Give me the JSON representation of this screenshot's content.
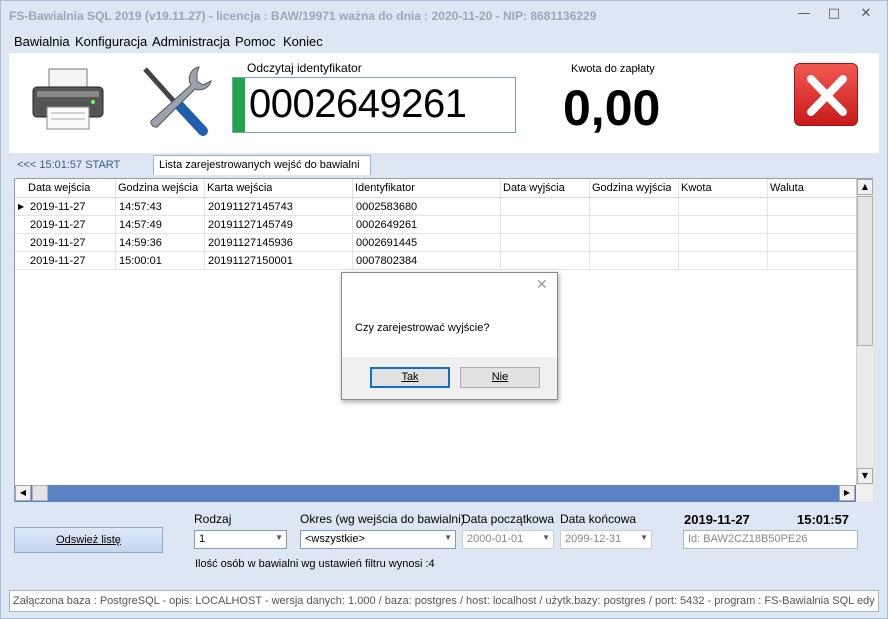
{
  "window": {
    "title": "FS-Bawialnia SQL 2019 (v19.11.27)   -   licencja : BAW/19971   ważna do dnia : 2020-11-20   -   NIP: 8681136229"
  },
  "menu": [
    "Bawialnia",
    "Konfiguracja",
    "Administracja",
    "Pomoc",
    "Koniec"
  ],
  "top": {
    "ident_label": "Odczytaj identyfikator",
    "ident_value": "0002649261",
    "amount_label": "Kwota do zapłaty",
    "amount_value": "0,00",
    "icons": [
      "printer-icon",
      "tools-icon",
      "close-icon"
    ]
  },
  "tabs": {
    "back": "<<<  15:01:57  START",
    "active": "Lista zarejestrowanych wejść do bawialni"
  },
  "grid": {
    "columns": [
      "Data wejścia",
      "Godzina wejścia",
      "Karta wejścia",
      "Identyfikator",
      "Data wyjścia",
      "Godzina wyjścia",
      "Kwota",
      "Waluta"
    ],
    "rows": [
      [
        "2019-11-27",
        "14:57:43",
        "20191127145743",
        "0002583680",
        "",
        "",
        "",
        ""
      ],
      [
        "2019-11-27",
        "14:57:49",
        "20191127145749",
        "0002649261",
        "",
        "",
        "",
        ""
      ],
      [
        "2019-11-27",
        "14:59:36",
        "20191127145936",
        "0002691445",
        "",
        "",
        "",
        ""
      ],
      [
        "2019-11-27",
        "15:00:01",
        "20191127150001",
        "0007802384",
        "",
        "",
        "",
        ""
      ]
    ]
  },
  "dialog": {
    "message": "Czy zarejestrować wyjście?",
    "yes": "Tak",
    "no": "Nie"
  },
  "filters": {
    "refresh": "Odswież listę",
    "rodzaj_label": "Rodzaj",
    "rodzaj_value": "1",
    "okres_label": "Okres (wg wejścia do bawialni)",
    "okres_value": "<wszystkie>",
    "date_from_label": "Data początkowa",
    "date_from_value": "2000-01-01",
    "date_to_label": "Data końcowa",
    "date_to_value": "2099-12-31",
    "current_date": "2019-11-27",
    "current_time": "15:01:57",
    "id_value": "Id: BAW2CZ18B50PE26",
    "count_text": "Ilość osób w bawialni wg ustawień filtru wynosi :4"
  },
  "status": "Załączona baza : PostgreSQL - opis: LOCALHOST - wersja danych: 1.000  / baza: postgres / host: localhost / użytk.bazy: postgres /  port: 5432  - program :  FS-Bawialnia SQL edy"
}
